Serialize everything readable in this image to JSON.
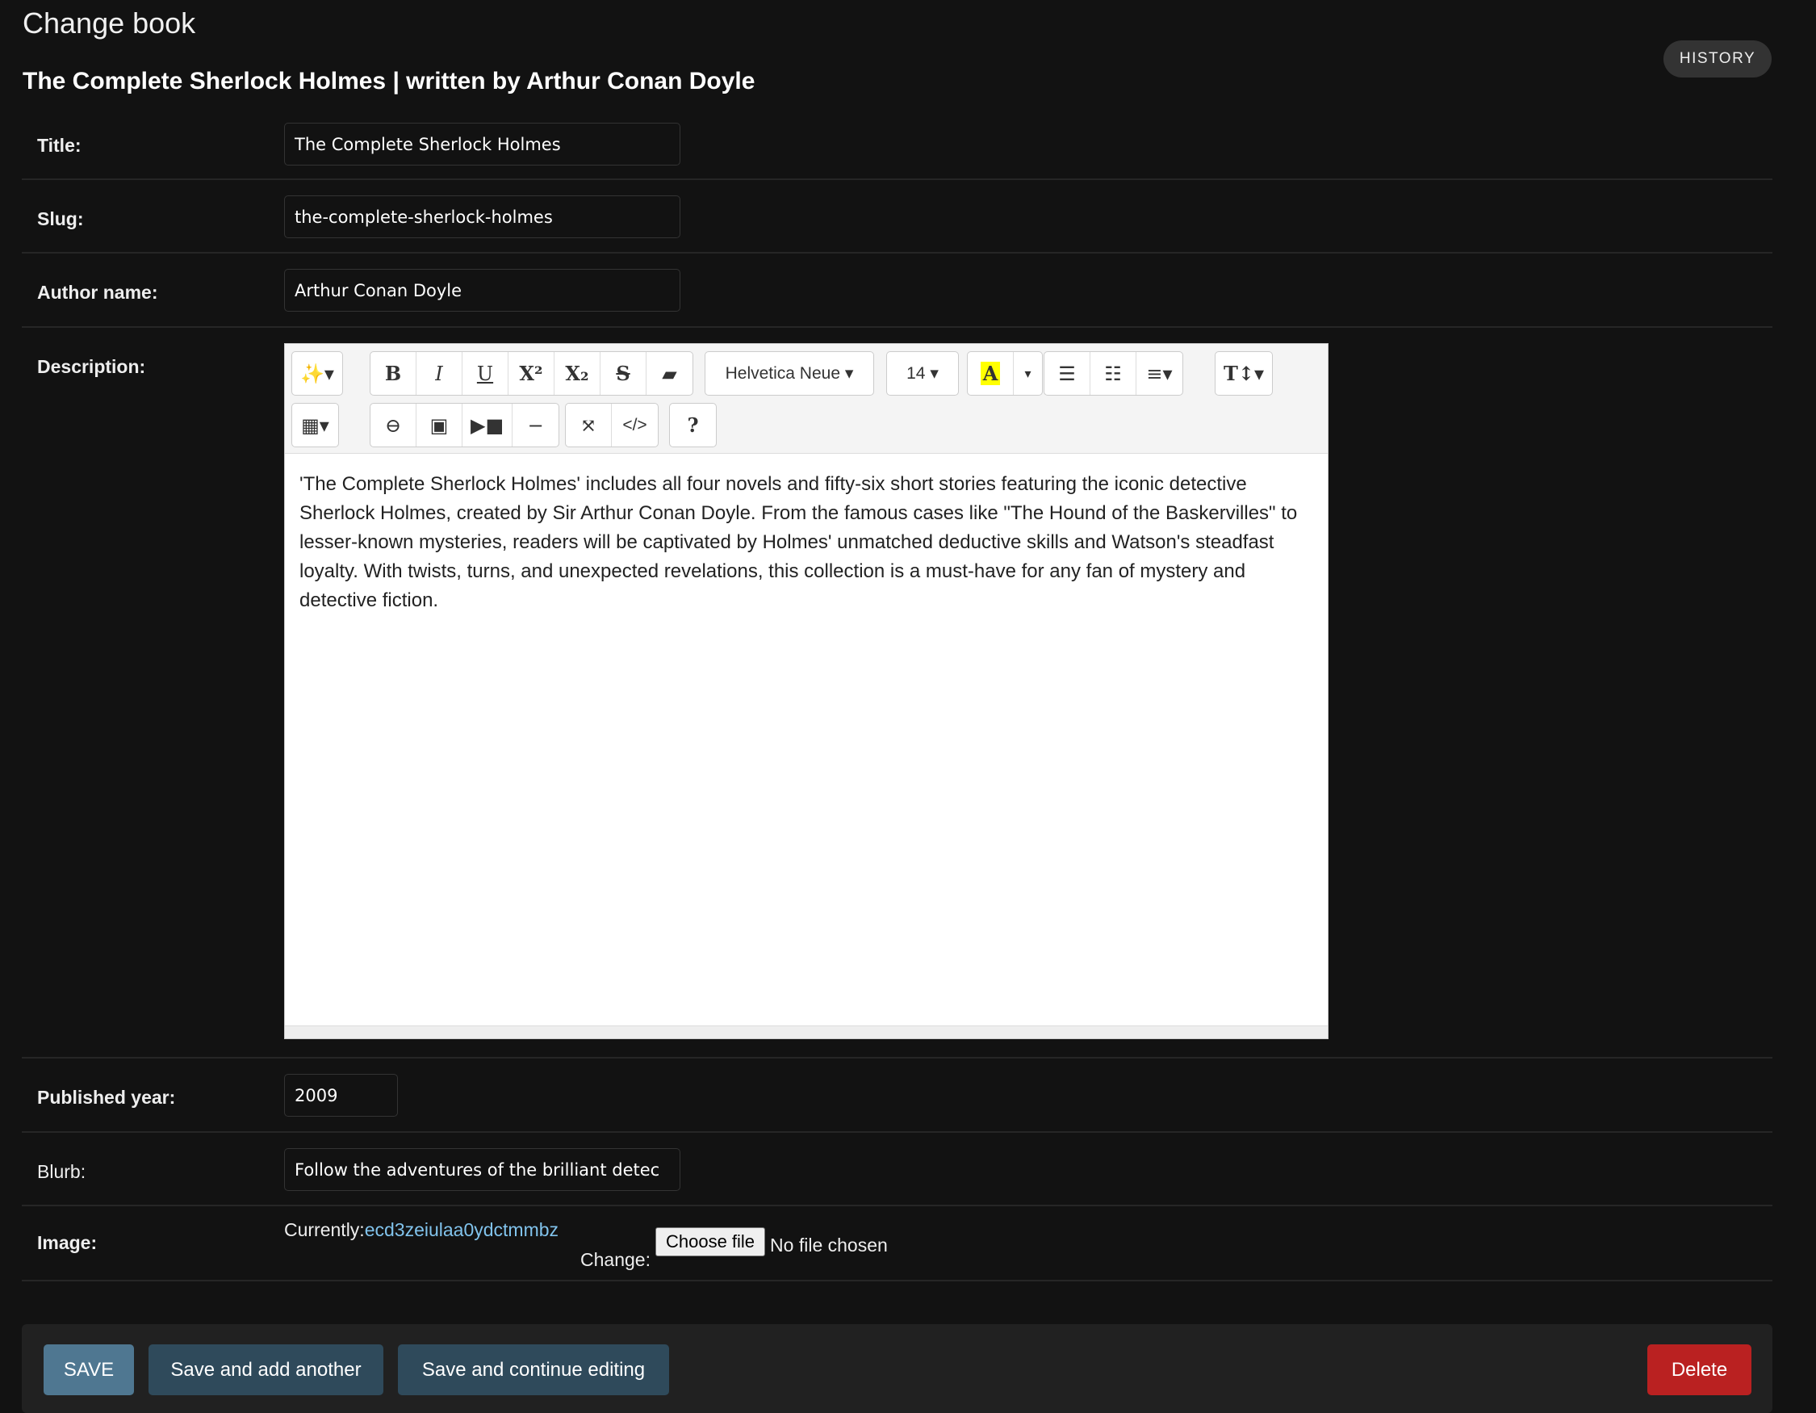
{
  "page": {
    "title": "Change book",
    "subtitle": "The Complete Sherlock Holmes | written by Arthur Conan Doyle",
    "history_label": "HISTORY"
  },
  "fields": {
    "title": {
      "label": "Title:",
      "value": "The Complete Sherlock Holmes"
    },
    "slug": {
      "label": "Slug:",
      "value": "the-complete-sherlock-holmes"
    },
    "author": {
      "label": "Author name:",
      "value": "Arthur Conan Doyle"
    },
    "description": {
      "label": "Description:",
      "value": "'The Complete Sherlock Holmes' includes all four novels and fifty-six short stories featuring the iconic detective Sherlock Holmes, created by Sir Arthur Conan Doyle. From the famous cases like \"The Hound of the Baskervilles\" to lesser-known mysteries, readers will be captivated by Holmes' unmatched deductive skills and Watson's steadfast loyalty. With twists, turns, and unexpected revelations, this collection is a must-have for any fan of mystery and detective fiction."
    },
    "published_year": {
      "label": "Published year:",
      "value": "2009"
    },
    "blurb": {
      "label": "Blurb:",
      "value": "Follow the adventures of the brilliant detec"
    },
    "image": {
      "label": "Image:",
      "currently_label": "Currently:",
      "current_file": "ecd3zeiulaa0ydctmmbz",
      "change_label": "Change:",
      "choose_label": "Choose file",
      "no_file": "No file chosen"
    }
  },
  "editor": {
    "font_name": "Helvetica Neue",
    "font_size": "14",
    "highlight_color": "#ffff00"
  },
  "actions": {
    "save": "SAVE",
    "save_add": "Save and add another",
    "save_continue": "Save and continue editing",
    "delete": "Delete"
  },
  "colors": {
    "save": "#4f7791",
    "secondary": "#2f4a5b",
    "delete": "#ba2121",
    "link": "#81c3ec"
  }
}
